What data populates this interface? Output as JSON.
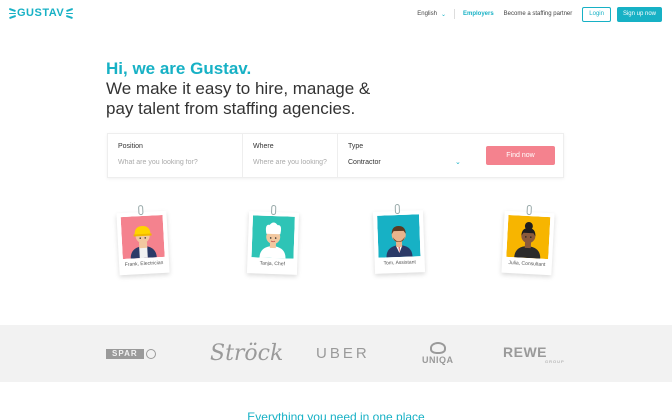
{
  "nav": {
    "logo": "GUSTAV",
    "language": "English",
    "employers": "Employers",
    "partner": "Become a staffing partner",
    "login": "Login",
    "signup": "Sign up now"
  },
  "hero": {
    "greeting": "Hi, we are Gustav.",
    "line1": "We make it easy to hire, manage &",
    "line2": "pay talent from staffing agencies."
  },
  "search": {
    "position_label": "Position",
    "position_placeholder": "What are you looking for?",
    "where_label": "Where",
    "where_placeholder": "Where are you looking?",
    "type_label": "Type",
    "type_value": "Contractor",
    "find_label": "Find now"
  },
  "cards": [
    {
      "caption": "Frank, Electrician",
      "bg": "#f4828e"
    },
    {
      "caption": "Tanja, Chef",
      "bg": "#2ec4b6"
    },
    {
      "caption": "Tom, Assistant",
      "bg": "#17b1c5"
    },
    {
      "caption": "Julia, Consultant",
      "bg": "#f7b500"
    }
  ],
  "brands": {
    "spar": "SPAR",
    "stroeck": "Ströck",
    "uber": "UBER",
    "uniqa": "UNIQA",
    "rewe": "REWE",
    "rewe_group": "GROUP"
  },
  "bottom_title": "Everything you need in one place",
  "colors": {
    "accent": "#17b1c5",
    "cta": "#f4828e"
  }
}
